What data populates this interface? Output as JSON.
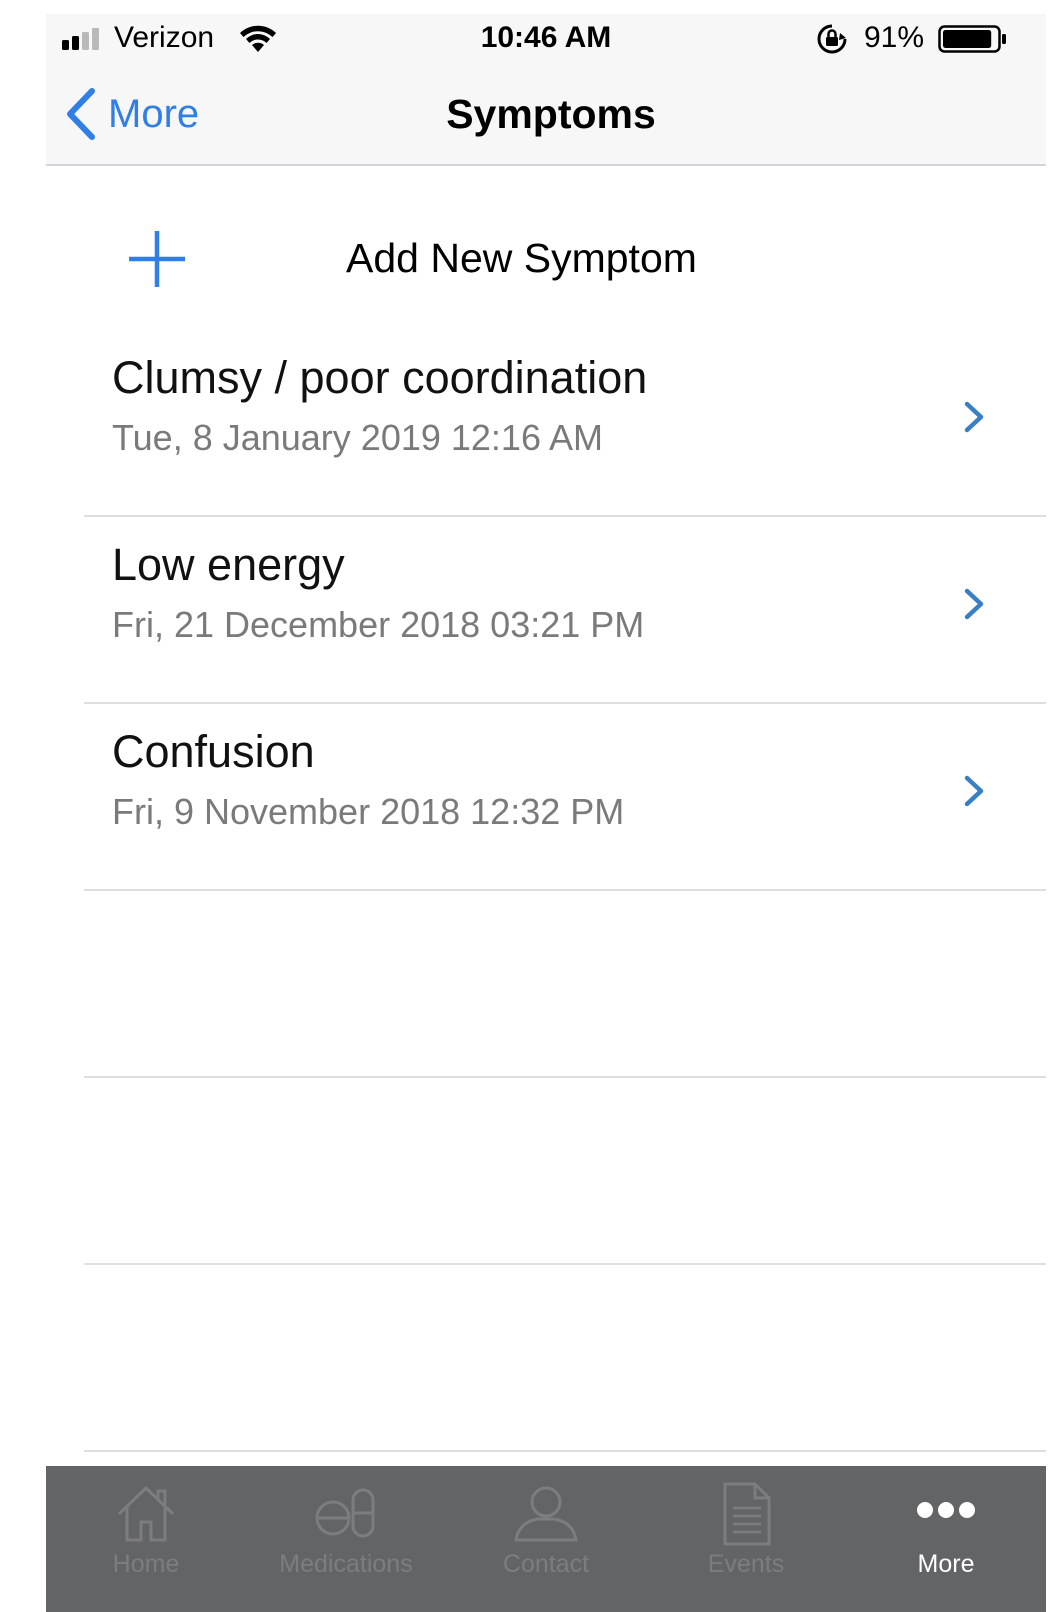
{
  "status_bar": {
    "carrier": "Verizon",
    "time": "10:46 AM",
    "battery_percent": "91%",
    "battery_level": 0.91
  },
  "nav": {
    "back_label": "More",
    "title": "Symptoms"
  },
  "add_row": {
    "label": "Add New Symptom",
    "icon": "plus-icon"
  },
  "symptoms": [
    {
      "title": "Clumsy / poor coordination",
      "date": "Tue, 8 January 2019 12:16 AM"
    },
    {
      "title": "Low energy",
      "date": "Fri, 21 December 2018 03:21 PM"
    },
    {
      "title": "Confusion",
      "date": "Fri, 9 November 2018 12:32 PM"
    }
  ],
  "tabs": [
    {
      "label": "Home",
      "icon": "home-icon",
      "active": false
    },
    {
      "label": "Medications",
      "icon": "pill-icon",
      "active": false
    },
    {
      "label": "Contact",
      "icon": "person-icon",
      "active": false
    },
    {
      "label": "Events",
      "icon": "document-icon",
      "active": false
    },
    {
      "label": "More",
      "icon": "more-dots-icon",
      "active": true
    }
  ],
  "colors": {
    "accent": "#2f7fe6",
    "chevron": "#3a7fc4",
    "tab_bar": "#636466",
    "bar_background": "#f7f7f7"
  }
}
